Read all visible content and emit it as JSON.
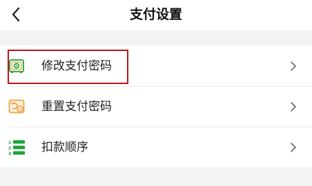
{
  "header": {
    "title": "支付设置",
    "back_icon": "chevron-left-icon"
  },
  "settings": {
    "items": [
      {
        "label": "修改支付密码",
        "icon": "safe-icon",
        "highlighted": true
      },
      {
        "label": "重置支付密码",
        "icon": "reset-card-icon",
        "highlighted": false
      },
      {
        "label": "扣款顺序",
        "icon": "numbered-list-icon",
        "highlighted": false
      }
    ],
    "chevron_icon": "chevron-right-icon"
  },
  "colors": {
    "icon_green": "#1aa33a",
    "icon_orange": "#f0a040",
    "highlight_red": "#c1121a"
  }
}
